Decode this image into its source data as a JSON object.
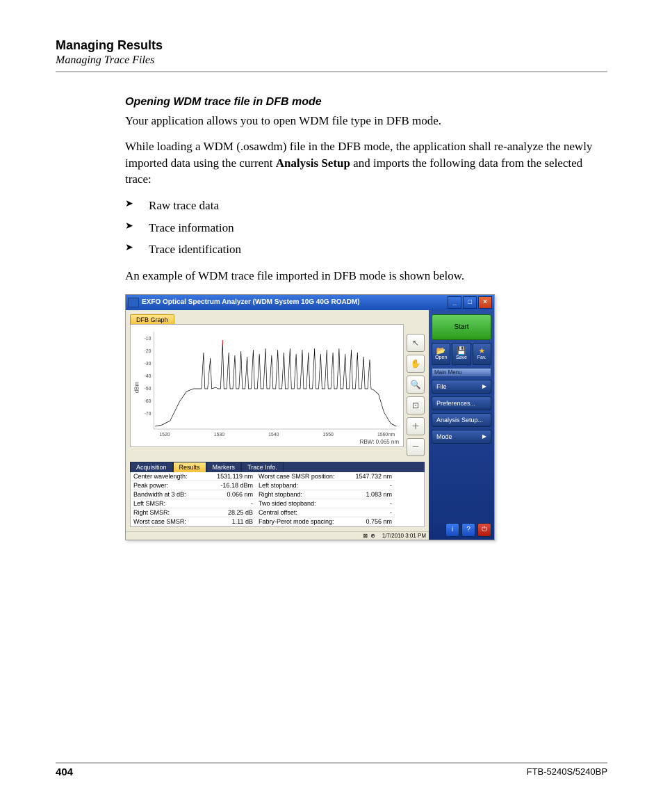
{
  "header": {
    "section": "Managing Results",
    "subsection": "Managing Trace Files"
  },
  "content": {
    "heading": "Opening WDM trace file in DFB mode",
    "p1": "Your application allows you to open WDM file type in DFB mode.",
    "p2a": "While loading a WDM (.osawdm) file in the DFB mode, the application shall re-analyze the newly imported data using the current ",
    "p2b": "Analysis Setup",
    "p2c": " and imports the following data from the selected trace:",
    "bullets": [
      "Raw trace data",
      "Trace information",
      "Trace identification"
    ],
    "p3": "An example of WDM trace file imported in DFB mode is shown below."
  },
  "screenshot": {
    "title": "EXFO Optical Spectrum Analyzer (WDM System 10G 40G ROADM)",
    "dfb_tab": "DFB Graph",
    "yaxis_label": "dBm",
    "yticks": [
      "-10",
      "-20",
      "-30",
      "-40",
      "-50",
      "-60",
      "-70"
    ],
    "xticks": [
      "1520",
      "1530",
      "1540",
      "1550",
      "1560"
    ],
    "xunit": "nm",
    "rbw": "RBW: 0.065 nm",
    "tabs": [
      "Acquisition",
      "Results",
      "Markers",
      "Trace Info."
    ],
    "results": {
      "left": [
        {
          "label": "Center wavelength:",
          "value": "1531.119 nm"
        },
        {
          "label": "Peak power:",
          "value": "-16.18 dBm"
        },
        {
          "label": "Bandwidth at 3 dB:",
          "value": "0.066 nm"
        },
        {
          "label": "Left SMSR:",
          "value": "-"
        },
        {
          "label": "Right SMSR:",
          "value": "28.25 dB"
        },
        {
          "label": "Worst case SMSR:",
          "value": "1.11 dB"
        }
      ],
      "right": [
        {
          "label": "Worst case SMSR position:",
          "value": "1547.732 nm"
        },
        {
          "label": "Left stopband:",
          "value": "-"
        },
        {
          "label": "Right stopband:",
          "value": "1.083 nm"
        },
        {
          "label": "Two sided stopband:",
          "value": "-"
        },
        {
          "label": "Central offset:",
          "value": "-"
        },
        {
          "label": "Fabry-Perot mode spacing:",
          "value": "0.756 nm"
        }
      ]
    },
    "right_panel": {
      "start": "Start",
      "open": "Open",
      "save": "Save",
      "fav": "Fav.",
      "menu_head": "Main Menu",
      "items": [
        "File",
        "Preferences...",
        "Analysis Setup...",
        "Mode"
      ]
    },
    "statusbar": {
      "icons": "⊠ ⊕",
      "time": "1/7/2010 3:01 PM"
    }
  },
  "footer": {
    "page": "404",
    "model": "FTB-5240S/5240BP"
  },
  "chart_data": {
    "type": "line",
    "title": "DFB Graph",
    "xlabel": "nm",
    "ylabel": "dBm",
    "xlim": [
      1518,
      1567
    ],
    "ylim": [
      -80,
      -5
    ],
    "note": "WDM optical spectrum trace; dense comb of channels between ~1528 and 1562 nm with peak near -16.18 dBm at 1531.119 nm; baseline noise floor about -52 dBm on left shoulder and dropping toward -75 dBm at extremes; approx 40 narrow peaks spaced ~0.8 nm rising from a shoulder around -50 dBm up to between -17 and -25 dBm."
  }
}
